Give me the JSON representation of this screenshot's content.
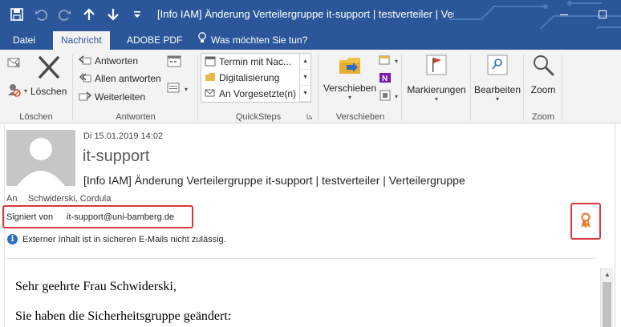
{
  "window": {
    "title": "[Info IAM] Änderung Verteilergruppe it-support | testverteiler | Verteile...",
    "minimize_icon": "minimize-icon",
    "restore_icon": "restore-icon"
  },
  "quick_access": [
    "save-icon",
    "undo-icon",
    "redo-icon",
    "up-arrow-icon",
    "down-arrow-icon",
    "customize-caret-icon"
  ],
  "tabs": [
    {
      "label": "Datei",
      "active": false
    },
    {
      "label": "Nachricht",
      "active": true
    },
    {
      "label": "ADOBE PDF",
      "active": false
    }
  ],
  "tell_me": {
    "label": "Was möchten Sie tun?",
    "icon": "lightbulb-icon"
  },
  "ribbon": {
    "loeschen": {
      "label": "Löschen",
      "delete_label": "Löschen"
    },
    "antworten": {
      "label": "Antworten",
      "reply": "Antworten",
      "reply_all": "Allen antworten",
      "forward": "Weiterleiten"
    },
    "quicksteps": {
      "label": "QuickSteps",
      "items": [
        "Termin mit Nac...",
        "Digitalisierung",
        "An Vorgesetzte(n)"
      ]
    },
    "verschieben": {
      "label": "Verschieben",
      "move": "Verschieben"
    },
    "markierungen": {
      "label": "Markierungen"
    },
    "bearbeiten": {
      "label": "Bearbeiten"
    },
    "zoom": {
      "label": "Zoom",
      "zoom_label": "Zoom"
    }
  },
  "message": {
    "date": "Di 15.01.2019 14:02",
    "sender": "it-support",
    "subject": "[Info IAM] Änderung Verteilergruppe it-support | testverteiler | Verteilergruppe",
    "to_label": "An",
    "to_value": "Schwiderski, Cordula",
    "signed_label": "Signiert von",
    "signed_value": "it-support@uni-bamberg.de",
    "info_text": "Externer Inhalt ist in sicheren E-Mails nicht zulässig."
  },
  "body": {
    "greeting": "Sehr geehrte Frau Schwiderski,",
    "line1": "Sie haben die Sicherheitsgruppe geändert:"
  },
  "colors": {
    "accent": "#2b579a",
    "highlight_box": "#d9373f",
    "badge": "#e87722"
  }
}
